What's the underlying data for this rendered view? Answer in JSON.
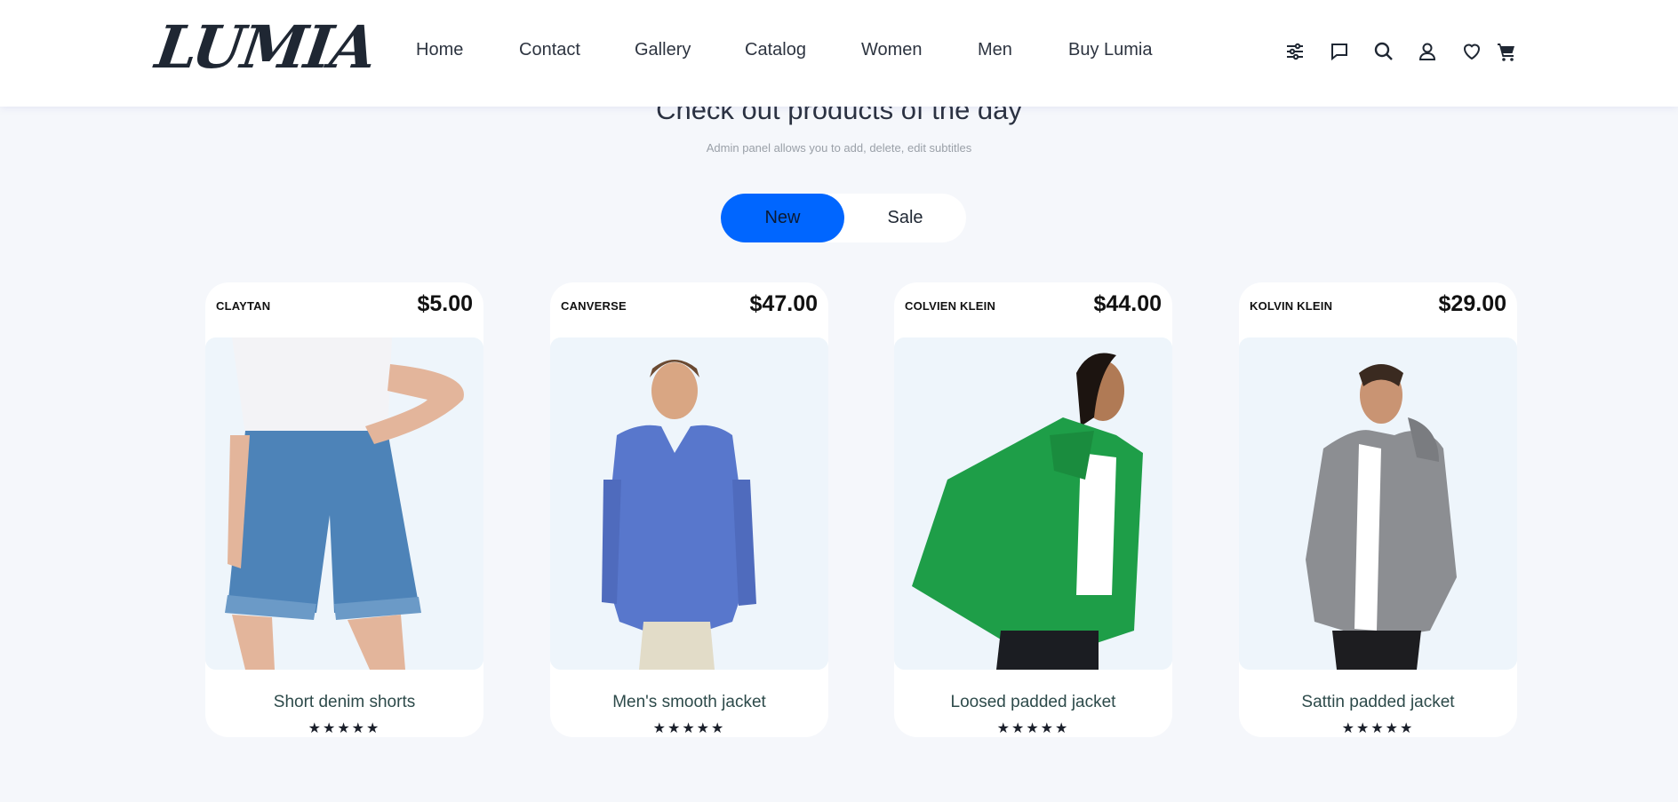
{
  "header": {
    "logo": "LUMIA",
    "nav": [
      "Home",
      "Contact",
      "Gallery",
      "Catalog",
      "Women",
      "Men",
      "Buy Lumia"
    ],
    "icons": [
      "filter-sliders-icon",
      "chat-icon",
      "search-icon",
      "user-icon",
      "heart-icon",
      "cart-icon"
    ]
  },
  "section": {
    "title": "Check out products of the day",
    "subtitle": "Admin panel allows you to add, delete, edit subtitles"
  },
  "toggle": {
    "options": [
      "New",
      "Sale"
    ],
    "active": "New",
    "active_color": "#0066ff"
  },
  "products": [
    {
      "brand": "CLAYTAN",
      "price": "$5.00",
      "name": "Short denim shorts",
      "stars": "★★★★★",
      "rating": 5
    },
    {
      "brand": "CANVERSE",
      "price": "$47.00",
      "name": "Men's smooth jacket",
      "stars": "★★★★★",
      "rating": 5
    },
    {
      "brand": "COLVIEN KLEIN",
      "price": "$44.00",
      "name": "Loosed padded jacket",
      "stars": "★★★★★",
      "rating": 5
    },
    {
      "brand": "KOLVIN KLEIN",
      "price": "$29.00",
      "name": "Sattin padded jacket",
      "stars": "★★★★★",
      "rating": 5
    }
  ]
}
